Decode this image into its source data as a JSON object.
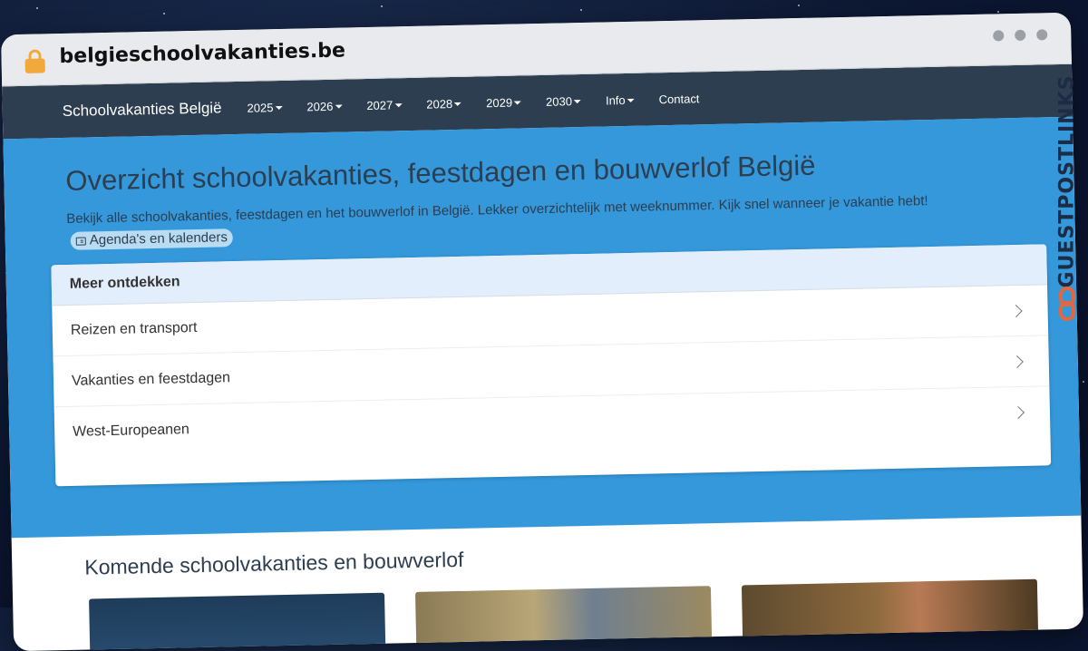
{
  "browser": {
    "url": "belgieschoolvakanties.be",
    "lock_icon": "lock-icon"
  },
  "navbar": {
    "brand": "Schoolvakanties België",
    "items": [
      {
        "label": "2025",
        "dropdown": true
      },
      {
        "label": "2026",
        "dropdown": true
      },
      {
        "label": "2027",
        "dropdown": true
      },
      {
        "label": "2028",
        "dropdown": true
      },
      {
        "label": "2029",
        "dropdown": true
      },
      {
        "label": "2030",
        "dropdown": true
      },
      {
        "label": "Info",
        "dropdown": true
      },
      {
        "label": "Contact",
        "dropdown": false
      }
    ]
  },
  "hero": {
    "title": "Overzicht schoolvakanties, feestdagen en bouwverlof België",
    "subtitle": "Bekijk alle schoolvakanties, feestdagen en het bouwverlof in België. Lekker overzichtelijk met weeknummer. Kijk snel wanneer je vakantie hebt!",
    "pill_label": "Agenda's en kalenders",
    "pill_icon": "calendar-card-icon"
  },
  "discover": {
    "header": "Meer ontdekken",
    "items": [
      {
        "label": "Reizen en transport"
      },
      {
        "label": "Vakanties en feestdagen"
      },
      {
        "label": "West-Europeanen"
      }
    ]
  },
  "upcoming": {
    "title": "Komende schoolvakanties en bouwverlof"
  },
  "watermark": {
    "text": "GUESTPOSTLINKS"
  },
  "colors": {
    "navbar": "#2c3e50",
    "hero": "#3498db",
    "accent": "#e3663c"
  }
}
